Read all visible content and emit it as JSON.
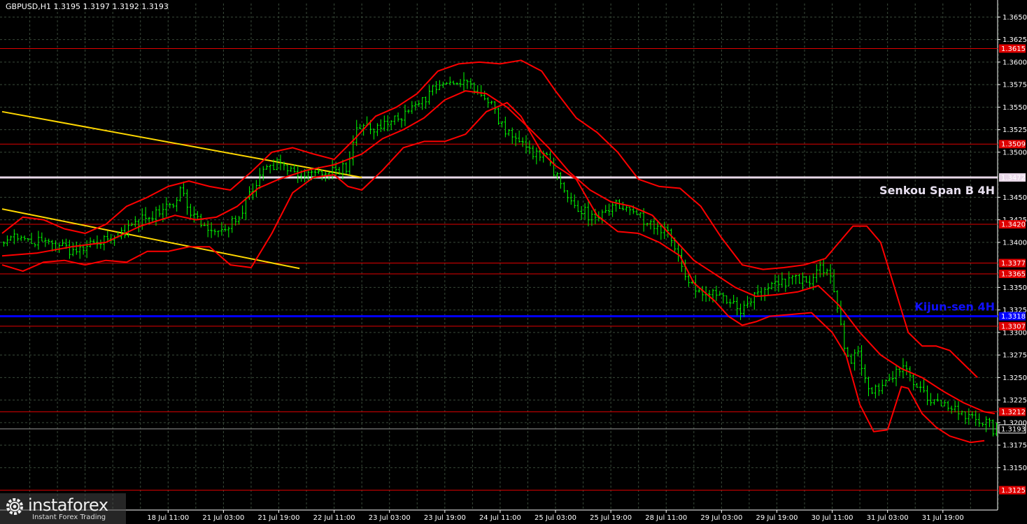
{
  "header": {
    "symbol_line": "GBPUSD,H1  1.3195 1.3197 1.3192 1.3193"
  },
  "colors": {
    "background": "#000000",
    "grid": "#3a4a3a",
    "candle": "#00ff00",
    "ichimoku_lines": "#ff0000",
    "level_lines": "#e00000",
    "trendline": "#ffd700",
    "senkou_span_b": "#e8d8e8",
    "kijun_sen": "#0000ff"
  },
  "annotations": {
    "senkou": "Senkou Span B 4H",
    "kijun": "Kijun-sen 4H"
  },
  "logo": {
    "brand": "instaforex",
    "tagline": "Instant Forex Trading"
  },
  "chart_data": {
    "type": "candlestick",
    "title": "GBPUSD,H1",
    "last_quote": {
      "bid": 1.3195,
      "high": 1.3197,
      "low": 1.3192,
      "close": 1.3193
    },
    "y_range": [
      1.3103,
      1.3665
    ],
    "y_ticks": [
      1.365,
      1.3625,
      1.36,
      1.3575,
      1.355,
      1.3525,
      1.35,
      1.345,
      1.3425,
      1.34,
      1.335,
      1.3325,
      1.33,
      1.3275,
      1.325,
      1.3225,
      1.32,
      1.3175,
      1.315
    ],
    "x_ticks": [
      "18 Jul 11:00",
      "21 Jul 03:00",
      "21 Jul 19:00",
      "22 Jul 11:00",
      "23 Jul 03:00",
      "23 Jul 19:00",
      "24 Jul 11:00",
      "25 Jul 03:00",
      "25 Jul 19:00",
      "28 Jul 11:00",
      "29 Jul 03:00",
      "29 Jul 19:00",
      "30 Jul 11:00",
      "31 Jul 03:00",
      "31 Jul 19:00"
    ],
    "x_tick_index": [
      48,
      64,
      80,
      96,
      112,
      128,
      144,
      160,
      176,
      192,
      208,
      224,
      240,
      256,
      272
    ],
    "horizontal_levels": [
      {
        "value": 1.3615,
        "label": "1.3615",
        "kind": "resistance"
      },
      {
        "value": 1.3509,
        "label": "1.3509",
        "kind": "resistance"
      },
      {
        "value": 1.3472,
        "label": "1.3472",
        "kind": "senkou_span_b"
      },
      {
        "value": 1.342,
        "label": "1.3420",
        "kind": "resistance"
      },
      {
        "value": 1.3377,
        "label": "1.3377",
        "kind": "support"
      },
      {
        "value": 1.3365,
        "label": "1.3365",
        "kind": "support"
      },
      {
        "value": 1.3318,
        "label": "1.3318",
        "kind": "kijun_sen"
      },
      {
        "value": 1.3307,
        "label": "1.3307",
        "kind": "support"
      },
      {
        "value": 1.3212,
        "label": "1.3212",
        "kind": "support"
      },
      {
        "value": 1.3193,
        "label": "1.3193",
        "kind": "current_price"
      },
      {
        "value": 1.3125,
        "label": "1.3125",
        "kind": "support"
      }
    ],
    "trendlines": [
      {
        "from": [
          0,
          1.3545
        ],
        "to": [
          104,
          1.3472
        ]
      },
      {
        "from": [
          0,
          1.3437
        ],
        "to": [
          86,
          1.3371
        ]
      }
    ],
    "price_path": [
      [
        0,
        1.34
      ],
      [
        6,
        1.3408
      ],
      [
        10,
        1.34
      ],
      [
        16,
        1.3398
      ],
      [
        22,
        1.3388
      ],
      [
        28,
        1.3402
      ],
      [
        34,
        1.3405
      ],
      [
        38,
        1.342
      ],
      [
        44,
        1.3432
      ],
      [
        50,
        1.344
      ],
      [
        52,
        1.3462
      ],
      [
        54,
        1.344
      ],
      [
        58,
        1.342
      ],
      [
        62,
        1.3412
      ],
      [
        66,
        1.342
      ],
      [
        70,
        1.3435
      ],
      [
        72,
        1.3452
      ],
      [
        76,
        1.3483
      ],
      [
        80,
        1.3488
      ],
      [
        84,
        1.3478
      ],
      [
        88,
        1.3478
      ],
      [
        92,
        1.3475
      ],
      [
        95,
        1.348
      ],
      [
        100,
        1.3482
      ],
      [
        103,
        1.3522
      ],
      [
        108,
        1.3528
      ],
      [
        112,
        1.3532
      ],
      [
        118,
        1.3545
      ],
      [
        122,
        1.3555
      ],
      [
        126,
        1.3575
      ],
      [
        130,
        1.3582
      ],
      [
        134,
        1.358
      ],
      [
        138,
        1.3565
      ],
      [
        142,
        1.355
      ],
      [
        146,
        1.3522
      ],
      [
        150,
        1.3508
      ],
      [
        154,
        1.35
      ],
      [
        158,
        1.3495
      ],
      [
        162,
        1.3465
      ],
      [
        166,
        1.3442
      ],
      [
        170,
        1.343
      ],
      [
        174,
        1.3432
      ],
      [
        178,
        1.344
      ],
      [
        182,
        1.3435
      ],
      [
        186,
        1.3425
      ],
      [
        190,
        1.3418
      ],
      [
        194,
        1.3405
      ],
      [
        198,
        1.336
      ],
      [
        202,
        1.3345
      ],
      [
        206,
        1.3345
      ],
      [
        210,
        1.3338
      ],
      [
        214,
        1.332
      ],
      [
        218,
        1.3342
      ],
      [
        222,
        1.335
      ],
      [
        226,
        1.3355
      ],
      [
        230,
        1.3358
      ],
      [
        234,
        1.336
      ],
      [
        238,
        1.3372
      ],
      [
        240,
        1.3362
      ],
      [
        242,
        1.333
      ],
      [
        244,
        1.328
      ],
      [
        246,
        1.3268
      ],
      [
        248,
        1.3275
      ],
      [
        250,
        1.325
      ],
      [
        252,
        1.323
      ],
      [
        256,
        1.3248
      ],
      [
        260,
        1.3255
      ],
      [
        262,
        1.326
      ],
      [
        264,
        1.3248
      ],
      [
        266,
        1.3235
      ],
      [
        270,
        1.3222
      ],
      [
        274,
        1.3218
      ],
      [
        278,
        1.3212
      ],
      [
        282,
        1.3205
      ],
      [
        286,
        1.32
      ],
      [
        287,
        1.3193
      ]
    ],
    "kijun_tenkan_line": [
      [
        0,
        1.3385
      ],
      [
        10,
        1.3388
      ],
      [
        20,
        1.3395
      ],
      [
        30,
        1.34
      ],
      [
        40,
        1.3418
      ],
      [
        50,
        1.343
      ],
      [
        56,
        1.3425
      ],
      [
        62,
        1.3428
      ],
      [
        68,
        1.344
      ],
      [
        74,
        1.346
      ],
      [
        80,
        1.347
      ],
      [
        88,
        1.348
      ],
      [
        96,
        1.3486
      ],
      [
        104,
        1.3498
      ],
      [
        110,
        1.3515
      ],
      [
        116,
        1.3525
      ],
      [
        122,
        1.3538
      ],
      [
        128,
        1.3558
      ],
      [
        134,
        1.3568
      ],
      [
        140,
        1.3565
      ],
      [
        146,
        1.355
      ],
      [
        152,
        1.3528
      ],
      [
        158,
        1.3505
      ],
      [
        164,
        1.3478
      ],
      [
        170,
        1.3458
      ],
      [
        176,
        1.3445
      ],
      [
        182,
        1.344
      ],
      [
        188,
        1.343
      ],
      [
        194,
        1.3405
      ],
      [
        200,
        1.338
      ],
      [
        206,
        1.3365
      ],
      [
        212,
        1.335
      ],
      [
        218,
        1.334
      ],
      [
        224,
        1.3342
      ],
      [
        230,
        1.3345
      ],
      [
        236,
        1.3352
      ],
      [
        242,
        1.333
      ],
      [
        248,
        1.33
      ],
      [
        254,
        1.3275
      ],
      [
        260,
        1.326
      ],
      [
        266,
        1.325
      ],
      [
        272,
        1.3235
      ],
      [
        278,
        1.3222
      ],
      [
        284,
        1.3212
      ],
      [
        287,
        1.321
      ]
    ],
    "upper_band": [
      [
        0,
        1.341
      ],
      [
        6,
        1.3428
      ],
      [
        12,
        1.3425
      ],
      [
        18,
        1.3415
      ],
      [
        24,
        1.341
      ],
      [
        30,
        1.342
      ],
      [
        36,
        1.344
      ],
      [
        42,
        1.345
      ],
      [
        48,
        1.3462
      ],
      [
        54,
        1.3468
      ],
      [
        60,
        1.3462
      ],
      [
        66,
        1.3458
      ],
      [
        72,
        1.3478
      ],
      [
        78,
        1.35
      ],
      [
        84,
        1.3505
      ],
      [
        90,
        1.3498
      ],
      [
        96,
        1.3492
      ],
      [
        102,
        1.3515
      ],
      [
        108,
        1.354
      ],
      [
        114,
        1.355
      ],
      [
        120,
        1.3565
      ],
      [
        126,
        1.359
      ],
      [
        132,
        1.3598
      ],
      [
        138,
        1.36
      ],
      [
        144,
        1.3598
      ],
      [
        150,
        1.3602
      ],
      [
        156,
        1.359
      ],
      [
        160,
        1.3568
      ],
      [
        166,
        1.3538
      ],
      [
        172,
        1.3522
      ],
      [
        178,
        1.35
      ],
      [
        184,
        1.347
      ],
      [
        190,
        1.3462
      ],
      [
        196,
        1.346
      ],
      [
        202,
        1.344
      ],
      [
        208,
        1.3405
      ],
      [
        214,
        1.3375
      ],
      [
        220,
        1.337
      ],
      [
        226,
        1.3372
      ],
      [
        232,
        1.3375
      ],
      [
        238,
        1.3382
      ],
      [
        242,
        1.34
      ],
      [
        246,
        1.3418
      ],
      [
        250,
        1.3418
      ],
      [
        254,
        1.34
      ],
      [
        258,
        1.335
      ],
      [
        262,
        1.33
      ],
      [
        266,
        1.3285
      ],
      [
        270,
        1.3285
      ],
      [
        274,
        1.328
      ],
      [
        278,
        1.3265
      ],
      [
        282,
        1.325
      ]
    ],
    "lower_band": [
      [
        0,
        1.3375
      ],
      [
        6,
        1.3368
      ],
      [
        12,
        1.3378
      ],
      [
        18,
        1.338
      ],
      [
        24,
        1.3375
      ],
      [
        30,
        1.338
      ],
      [
        36,
        1.3378
      ],
      [
        42,
        1.339
      ],
      [
        48,
        1.339
      ],
      [
        54,
        1.3395
      ],
      [
        60,
        1.3395
      ],
      [
        66,
        1.3375
      ],
      [
        72,
        1.3372
      ],
      [
        78,
        1.341
      ],
      [
        84,
        1.3455
      ],
      [
        90,
        1.3472
      ],
      [
        96,
        1.3475
      ],
      [
        100,
        1.3462
      ],
      [
        104,
        1.3458
      ],
      [
        110,
        1.348
      ],
      [
        116,
        1.3505
      ],
      [
        122,
        1.3512
      ],
      [
        128,
        1.3512
      ],
      [
        134,
        1.352
      ],
      [
        140,
        1.3545
      ],
      [
        146,
        1.3555
      ],
      [
        150,
        1.354
      ],
      [
        156,
        1.35
      ],
      [
        160,
        1.3485
      ],
      [
        166,
        1.347
      ],
      [
        172,
        1.343
      ],
      [
        178,
        1.3412
      ],
      [
        184,
        1.341
      ],
      [
        190,
        1.34
      ],
      [
        196,
        1.3385
      ],
      [
        200,
        1.3355
      ],
      [
        206,
        1.3335
      ],
      [
        210,
        1.3318
      ],
      [
        214,
        1.3308
      ],
      [
        218,
        1.3312
      ],
      [
        222,
        1.3318
      ],
      [
        228,
        1.332
      ],
      [
        234,
        1.3322
      ],
      [
        240,
        1.33
      ],
      [
        244,
        1.3275
      ],
      [
        248,
        1.322
      ],
      [
        252,
        1.319
      ],
      [
        256,
        1.3192
      ],
      [
        260,
        1.324
      ],
      [
        262,
        1.3238
      ],
      [
        266,
        1.321
      ],
      [
        270,
        1.3195
      ],
      [
        274,
        1.3185
      ],
      [
        280,
        1.3178
      ],
      [
        284,
        1.318
      ]
    ]
  }
}
